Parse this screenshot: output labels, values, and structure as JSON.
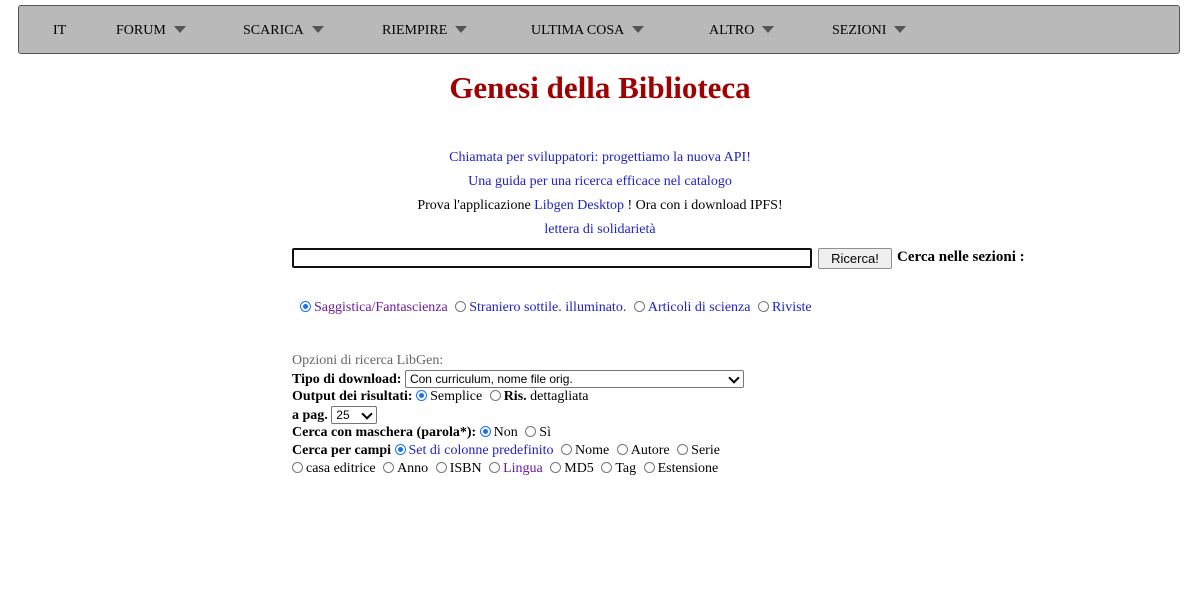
{
  "nav": {
    "items": [
      {
        "label": "IT",
        "dropdown": false
      },
      {
        "label": "FORUM",
        "dropdown": true
      },
      {
        "label": "SCARICA",
        "dropdown": true
      },
      {
        "label": "RIEMPIRE",
        "dropdown": true
      },
      {
        "label": "ULTIMA COSA",
        "dropdown": true
      },
      {
        "label": "ALTRO",
        "dropdown": true
      },
      {
        "label": "SEZIONI",
        "dropdown": true
      }
    ]
  },
  "title": "Genesi della Biblioteca",
  "notices": {
    "developers_link": "Chiamata per sviluppatori: progettiamo la nuova API!",
    "guide_link": "Una guida per una ricerca efficace nel catalogo",
    "desktop_prefix": "Prova l'applicazione ",
    "desktop_link": "Libgen Desktop",
    "desktop_suffix": " ! Ora con i download IPFS!",
    "solidarity_link": "lettera di solidarietà"
  },
  "search": {
    "value": "",
    "button_label": "Ricerca!",
    "sections_label": "Cerca nelle sezioni :"
  },
  "topics": [
    {
      "label": "Saggistica/Fantascienza",
      "selected": true
    },
    {
      "label": "Straniero sottile. illuminato.",
      "selected": false
    },
    {
      "label": "Articoli di scienza",
      "selected": false
    },
    {
      "label": "Riviste",
      "selected": false
    }
  ],
  "options": {
    "heading": "Opzioni di ricerca LibGen:",
    "download_type": {
      "label": "Tipo di download:",
      "value": "Con curriculum, nome file orig."
    },
    "output": {
      "label": "Output dei risultati:",
      "simple": "Semplice",
      "detailed_bold": "Ris.",
      "detailed_rest": " dettagliata",
      "selected": "simple"
    },
    "per_page": {
      "label": "a pag.",
      "value": "25"
    },
    "mask": {
      "label": "Cerca con maschera (parola*):",
      "no": "Non",
      "yes": "Sì",
      "selected": "no"
    },
    "fields": {
      "label": "Cerca per campi",
      "items": [
        {
          "label": "Set di colonne predefinito",
          "selected": true
        },
        {
          "label": "Nome",
          "selected": false
        },
        {
          "label": "Autore",
          "selected": false
        },
        {
          "label": "Serie",
          "selected": false
        },
        {
          "label": "casa editrice",
          "selected": false
        },
        {
          "label": "Anno",
          "selected": false
        },
        {
          "label": "ISBN",
          "selected": false
        },
        {
          "label": "Lingua",
          "selected": false
        },
        {
          "label": "MD5",
          "selected": false
        },
        {
          "label": "Tag",
          "selected": false
        },
        {
          "label": "Estensione",
          "selected": false
        }
      ]
    }
  },
  "colors": {
    "title": "#a00000",
    "link": "#1f22c4",
    "nav_bg": "#b9b9b9",
    "radio_accent": "#1a73e8"
  }
}
